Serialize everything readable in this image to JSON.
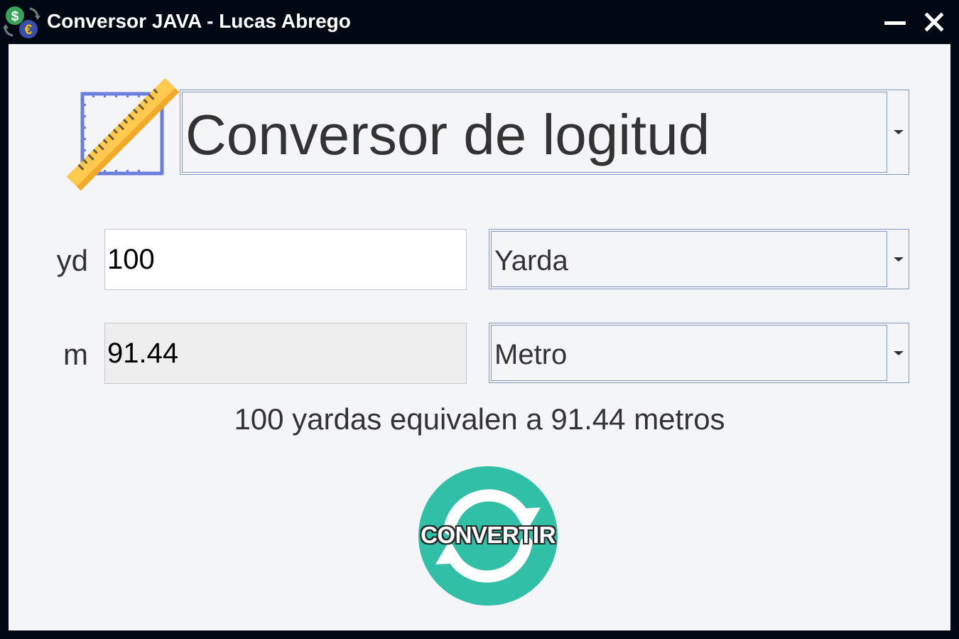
{
  "window": {
    "title": "Conversor JAVA - Lucas Abrego",
    "app_icon": "currency-exchange-icon",
    "minimize_icon": "minimize-icon",
    "close_icon": "close-icon"
  },
  "header": {
    "icon": "ruler-icon",
    "converter_type": "Conversor de logitud"
  },
  "input": {
    "unit_symbol": "yd",
    "value": "100",
    "unit_selected": "Yarda"
  },
  "output": {
    "unit_symbol": "m",
    "value": "91.44",
    "unit_selected": "Metro"
  },
  "result": {
    "text": "100 yardas equivalen a 91.44 metros"
  },
  "convert_button": {
    "label": "CONVERTIR",
    "icon": "refresh-icon",
    "color": "#32bfa8"
  },
  "colors": {
    "titlebar": "#000814",
    "content_bg": "#f3f5f9",
    "ruler_yellow": "#ffc94d",
    "ruler_frame": "#6a7fdc"
  }
}
